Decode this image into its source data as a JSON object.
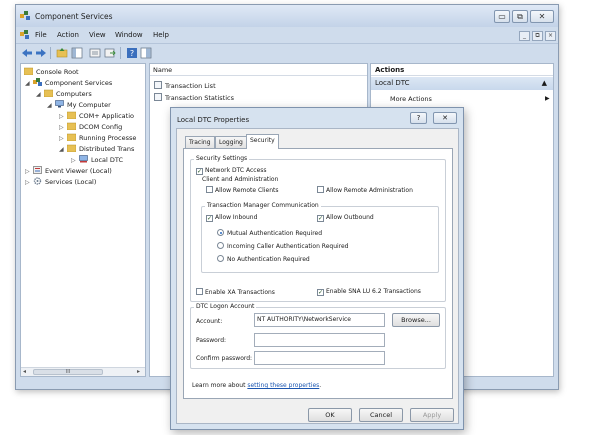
{
  "window": {
    "title": "Component Services",
    "controls": {
      "minimize": "▭",
      "restore": "⧉",
      "close": "✕"
    }
  },
  "menu": {
    "items": [
      "File",
      "Action",
      "View",
      "Window",
      "Help"
    ],
    "mdi_controls": [
      "_",
      "⧉",
      "×"
    ]
  },
  "tree": {
    "items": [
      {
        "label": "Console Root",
        "icon": "folder-icon"
      },
      {
        "label": "Component Services",
        "icon": "component-services-icon"
      },
      {
        "label": "Computers",
        "icon": "folder-icon"
      },
      {
        "label": "My Computer",
        "icon": "computer-icon"
      },
      {
        "label": "COM+ Applicatio",
        "icon": "folder-icon"
      },
      {
        "label": "DCOM Config",
        "icon": "folder-icon"
      },
      {
        "label": "Running Processe",
        "icon": "folder-icon"
      },
      {
        "label": "Distributed Trans",
        "icon": "folder-icon"
      },
      {
        "label": "Local DTC",
        "icon": "dtc-icon"
      },
      {
        "label": "Event Viewer (Local)",
        "icon": "event-viewer-icon"
      },
      {
        "label": "Services (Local)",
        "icon": "services-icon"
      }
    ],
    "scroll_thumb": "III"
  },
  "center": {
    "column_header": "Name",
    "rows": [
      "Transaction List",
      "Transaction Statistics"
    ]
  },
  "actions": {
    "title": "Actions",
    "section": "Local DTC",
    "items": [
      "More Actions"
    ]
  },
  "dialog": {
    "title": "Local DTC Properties",
    "help": "?",
    "close": "✕",
    "tabs": [
      "Tracing",
      "Logging",
      "Security"
    ],
    "active_tab": "Security",
    "security_settings": {
      "group_label": "Security Settings",
      "network_dtc_access": {
        "label": "Network DTC Access",
        "checked": true
      },
      "client_admin": {
        "group_label": "Client and Administration",
        "allow_remote_clients": {
          "label": "Allow Remote Clients",
          "checked": false
        },
        "allow_remote_admin": {
          "label": "Allow Remote Administration",
          "checked": false
        }
      },
      "tm_comm": {
        "group_label": "Transaction Manager Communication",
        "allow_inbound": {
          "label": "Allow Inbound",
          "checked": true
        },
        "allow_outbound": {
          "label": "Allow Outbound",
          "checked": true
        },
        "auth_options": [
          {
            "label": "Mutual Authentication Required",
            "selected": true
          },
          {
            "label": "Incoming Caller Authentication Required",
            "selected": false
          },
          {
            "label": "No Authentication Required",
            "selected": false
          }
        ]
      },
      "enable_xa": {
        "label": "Enable XA Transactions",
        "checked": false
      },
      "enable_sna": {
        "label": "Enable SNA LU 6.2 Transactions",
        "checked": true
      }
    },
    "logon": {
      "group_label": "DTC Logon Account",
      "account_label": "Account:",
      "account_value": "NT AUTHORITY\\NetworkService",
      "browse_label": "Browse...",
      "password_label": "Password:",
      "password_value": "",
      "confirm_label": "Confirm password:",
      "confirm_value": ""
    },
    "learn_more_prefix": "Learn more about",
    "learn_more_link": "setting these properties",
    "learn_more_suffix": ".",
    "buttons": {
      "ok": "OK",
      "cancel": "Cancel",
      "apply": "Apply"
    }
  }
}
